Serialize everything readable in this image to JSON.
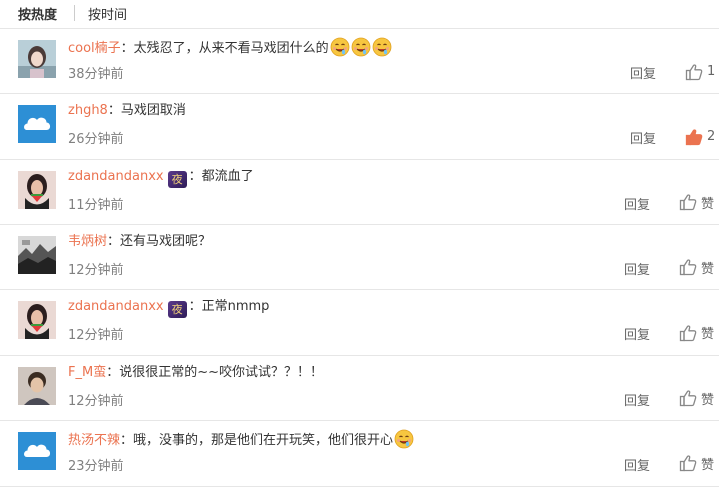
{
  "sort": {
    "hot_label": "按热度",
    "time_label": "按时间"
  },
  "comments": [
    {
      "username": "cool楠子",
      "text": "：太残忍了，从来不看马戏团什么的",
      "emoji_count": 3,
      "vip": false,
      "time": "38分钟前",
      "reply_label": "回复",
      "like_label": "1",
      "liked": false,
      "avatar": "avatar-girl-photo"
    },
    {
      "username": "zhgh8",
      "text": "：马戏团取消",
      "emoji_count": 0,
      "vip": false,
      "time": "26分钟前",
      "reply_label": "回复",
      "like_label": "2",
      "liked": true,
      "avatar": "avatar-default-cloud"
    },
    {
      "username": "zdandandanxx",
      "vip_badge": "夜",
      "text": "：都流血了",
      "emoji_count": 0,
      "vip": true,
      "time": "11分钟前",
      "reply_label": "回复",
      "like_label": "赞",
      "liked": false,
      "avatar": "avatar-woman-watermelon"
    },
    {
      "username": "韦炳树",
      "text": "：还有马戏团呢？",
      "emoji_count": 0,
      "vip": false,
      "time": "12分钟前",
      "reply_label": "回复",
      "like_label": "赞",
      "liked": false,
      "avatar": "avatar-bw-landscape"
    },
    {
      "username": "zdandandanxx",
      "vip_badge": "夜",
      "text": "：正常nmmp",
      "emoji_count": 0,
      "vip": true,
      "time": "12分钟前",
      "reply_label": "回复",
      "like_label": "赞",
      "liked": false,
      "avatar": "avatar-woman-watermelon"
    },
    {
      "username": "F_M蛮",
      "text": "：说很很正常的~~咬你试试？？！！",
      "emoji_count": 0,
      "vip": false,
      "time": "12分钟前",
      "reply_label": "回复",
      "like_label": "赞",
      "liked": false,
      "avatar": "avatar-child-photo"
    },
    {
      "username": "热汤不辣",
      "text": "：哦，没事的，那是他们在开玩笑，他们很开心",
      "emoji_count": 1,
      "vip": false,
      "time": "23分钟前",
      "reply_label": "回复",
      "like_label": "赞",
      "liked": false,
      "avatar": "avatar-default-cloud"
    }
  ],
  "colors": {
    "username": "#eb7350",
    "liked_thumb": "#eb7350",
    "thumb": "#888888",
    "divider": "#e6e6e6"
  }
}
